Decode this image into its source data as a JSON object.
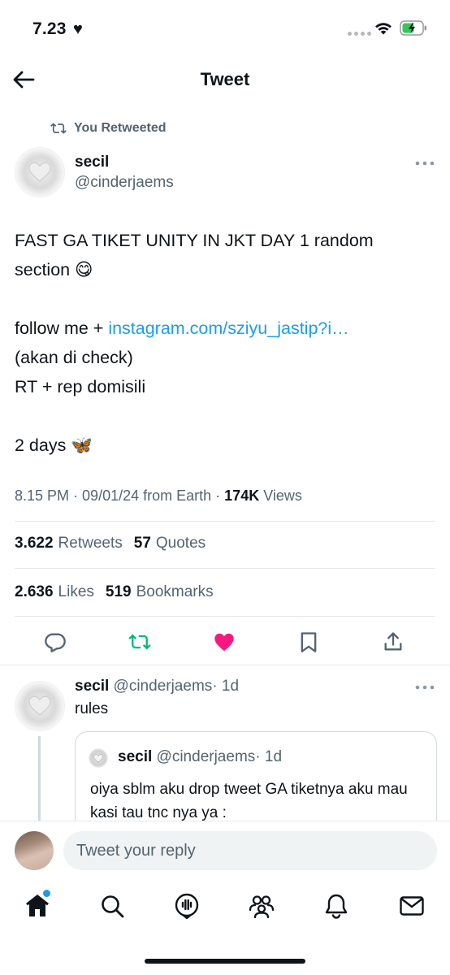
{
  "status_bar": {
    "time": "7.23",
    "heart": "♥"
  },
  "header": {
    "title": "Tweet",
    "back_icon": "back-arrow-icon"
  },
  "retweet_context": {
    "label": "You Retweeted"
  },
  "tweet": {
    "author_name": "secil",
    "author_handle": "@cinderjaems",
    "line1": "FAST GA TIKET UNITY IN JKT DAY 1 random",
    "line2": "section 😋",
    "line3_prefix": "follow me + ",
    "link": "instagram.com/sziyu_jastip?i…",
    "line4": "(akan di check)",
    "line5": "RT + rep domisili",
    "line6": "2 days 🦋",
    "time": "8.15 PM",
    "date": "09/01/24",
    "source": "from Earth",
    "views_count": "174K",
    "views_label": "Views"
  },
  "stats": {
    "retweets_count": "3.622",
    "retweets_label": "Retweets",
    "quotes_count": "57",
    "quotes_label": "Quotes",
    "likes_count": "2.636",
    "likes_label": "Likes",
    "bookmarks_count": "519",
    "bookmarks_label": "Bookmarks"
  },
  "colors": {
    "accent": "#1d9bf0",
    "retweet": "#00ba7c",
    "like": "#f91880",
    "muted": "#536471"
  },
  "reply": {
    "author_name": "secil",
    "author_handle": "@cinderjaems",
    "age": "· 1d",
    "text": "rules",
    "quote": {
      "author_name": "secil",
      "author_handle": "@cinderjaems",
      "age": "· 1d",
      "text": "oiya sblm aku drop tweet GA tiketnya aku mau kasi tau tnc nya ya :"
    }
  },
  "composer": {
    "placeholder": "Tweet your reply"
  },
  "bottom_nav": {
    "items": [
      "home-icon",
      "search-icon",
      "spaces-icon",
      "communities-icon",
      "notifications-icon",
      "messages-icon"
    ]
  }
}
